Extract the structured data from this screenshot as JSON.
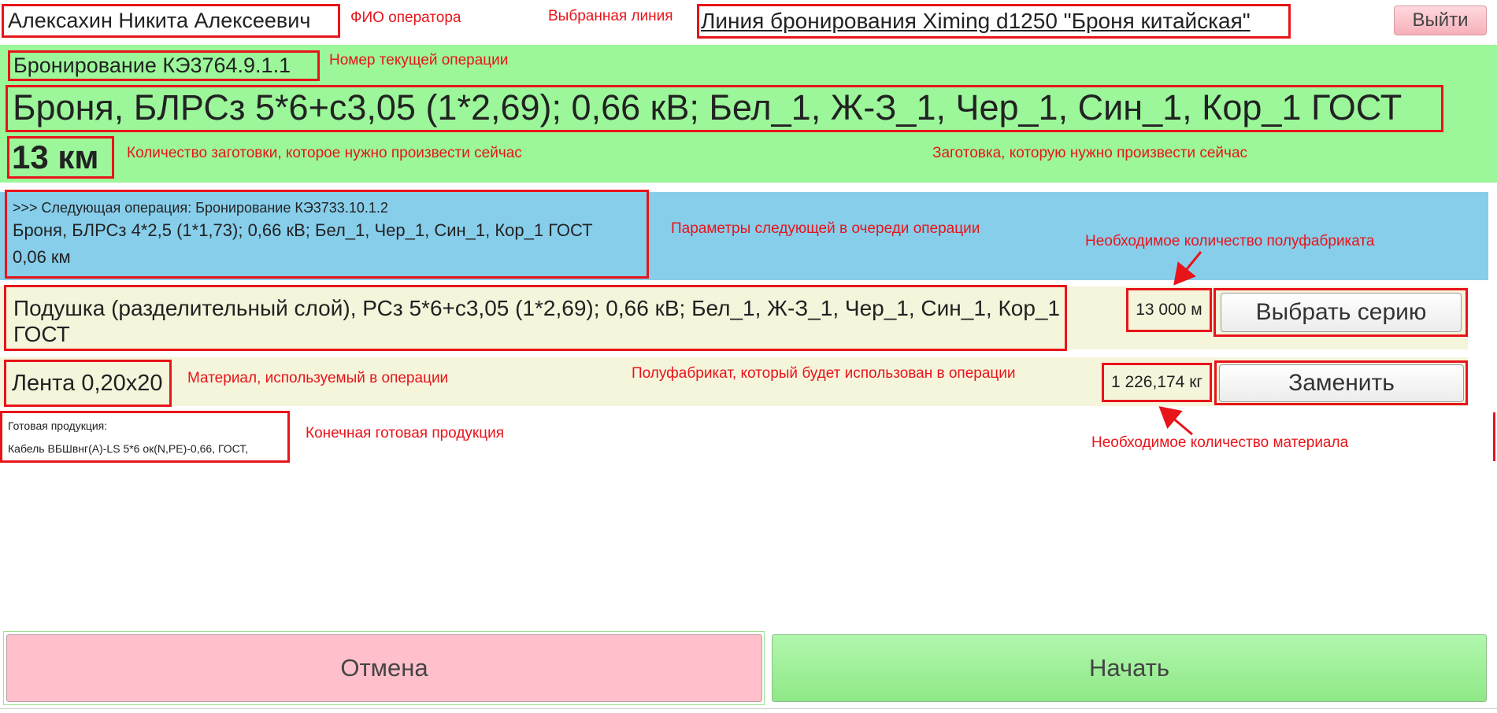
{
  "header": {
    "operator_name": "Алексахин Никита Алексеевич",
    "line_name": "Линия бронирования Ximing d1250 \"Броня китайская\"",
    "logout_label": "Выйти"
  },
  "current_operation": {
    "number": "Бронирование КЭ3764.9.1.1",
    "product": "Броня, БЛРСз 5*6+с3,05 (1*2,69); 0,66 кВ; Бел_1, Ж-З_1, Чер_1, Син_1, Кор_1 ГОСТ",
    "quantity": "13 км"
  },
  "next_operation": {
    "title": ">>> Следующая операция: Бронирование КЭ3733.10.1.2",
    "product": "Броня, БЛРСз 4*2,5 (1*1,73); 0,66 кВ; Бел_1, Чер_1, Син_1, Кор_1 ГОСТ",
    "quantity": "0,06 км"
  },
  "semi_product": {
    "name": "Подушка (разделительный слой), РСз 5*6+с3,05 (1*2,69); 0,66 кВ; Бел_1, Ж-З_1, Чер_1, Син_1, Кор_1 ГОСТ",
    "quantity": "13 000 м",
    "button_label": "Выбрать серию"
  },
  "material": {
    "name": "Лента 0,20х20",
    "quantity": "1 226,174 кг",
    "button_label": "Заменить"
  },
  "finished_product": {
    "label": "Готовая продукция:",
    "value": "Кабель ВБШвнг(А)-LS 5*6 ок(N,PE)-0,66, ГОСТ,"
  },
  "annotations": {
    "operator": "ФИО оператора",
    "line": "Выбранная линия",
    "op_number": "Номер текущей операции",
    "qty_now": "Количество заготовки, которое нужно произвести сейчас",
    "blank_now": "Заготовка, которую нужно произвести сейчас",
    "next_params": "Параметры следующей в очереди операции",
    "semi_qty": "Необходимое количество полуфабриката",
    "material": "Материал, используемый в операции",
    "semi_used": "Полуфабрикат, который будет использован в операции",
    "finished": "Конечная готовая продукция",
    "mat_qty": "Необходимое количество материала"
  },
  "footer": {
    "cancel_label": "Отмена",
    "start_label": "Начать"
  },
  "colors": {
    "annotation_red": "#e8141a",
    "current_panel": "#9bf79a",
    "next_panel": "#87ceeb",
    "row_panel": "#f5f5dc",
    "cancel": "#ffc0cb",
    "start": "#9bf79a"
  }
}
